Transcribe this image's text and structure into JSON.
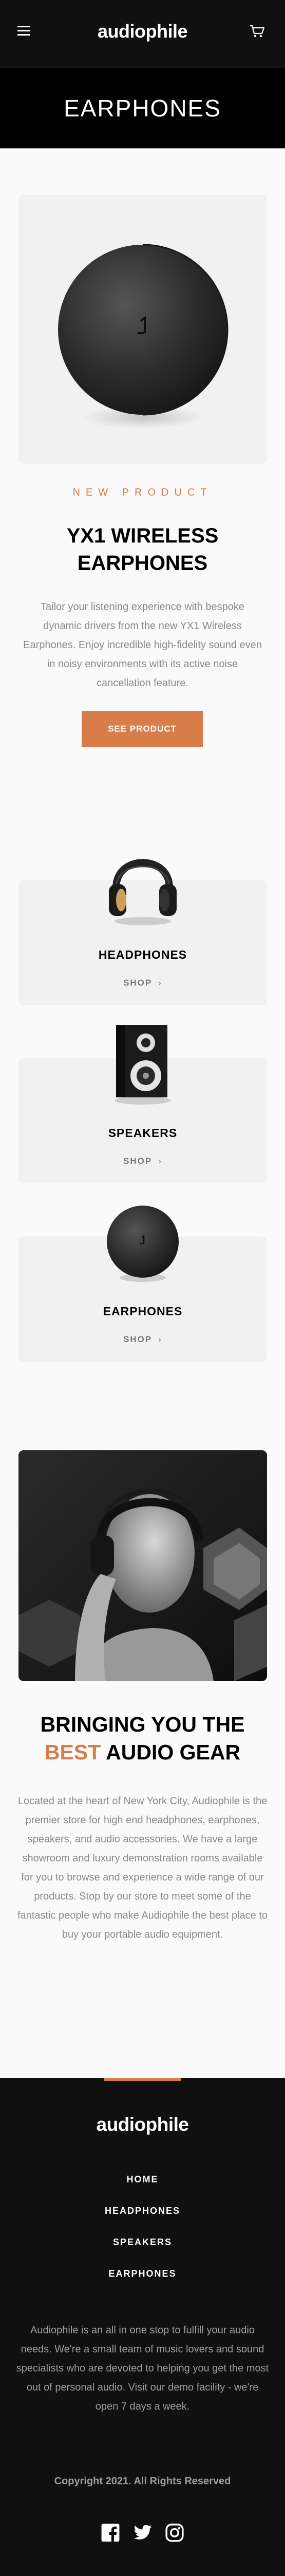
{
  "header": {
    "logo": "audiophile",
    "menu_icon": "hamburger-icon",
    "cart_icon": "cart-icon"
  },
  "category_banner": {
    "title": "EARPHONES"
  },
  "product": {
    "overline": "NEW PRODUCT",
    "title_line1": "YX1 WIRELESS",
    "title_line2": "EARPHONES",
    "description": "Tailor your listening experience with bespoke dynamic drivers from the new YX1 Wireless Earphones. Enjoy incredible high-fidelity sound even in noisy environments with its active noise cancellation feature.",
    "cta_label": "SEE PRODUCT"
  },
  "categories": [
    {
      "name": "HEADPHONES",
      "shop_label": "SHOP"
    },
    {
      "name": "SPEAKERS",
      "shop_label": "SHOP"
    },
    {
      "name": "EARPHONES",
      "shop_label": "SHOP"
    }
  ],
  "about": {
    "title_line1": "BRINGING YOU THE",
    "title_accent": "BEST",
    "title_rest": "AUDIO GEAR",
    "text": "Located at the heart of New York City, Audiophile is the premier store for high end headphones, earphones, speakers, and audio accessories. We have a large showroom and luxury demonstration rooms available for you to browse and experience a wide range of our products. Stop by our store to meet some of the fantastic people who make Audiophile the best place to buy your portable audio equipment."
  },
  "footer": {
    "logo": "audiophile",
    "nav": [
      "HOME",
      "HEADPHONES",
      "SPEAKERS",
      "EARPHONES"
    ],
    "description": "Audiophile is an all in one stop to fulfill your audio needs. We're a small team of music lovers and sound specialists who are devoted to helping you get the most out of personal audio. Visit our demo facility - we're open 7 days a week.",
    "copyright": "Copyright 2021. All Rights Reserved",
    "socials": [
      "facebook-icon",
      "twitter-icon",
      "instagram-icon"
    ]
  },
  "colors": {
    "accent": "#d87d4a",
    "dark": "#101010",
    "card_bg": "#f1f1f1",
    "page_bg": "#fafafa"
  }
}
